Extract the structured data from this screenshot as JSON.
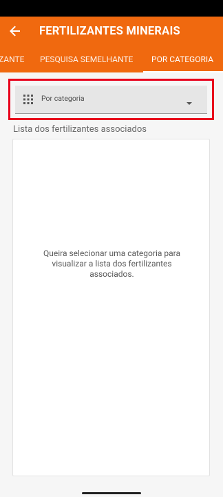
{
  "app_bar": {
    "title": "FERTILIZANTES MINERAIS",
    "back_icon": "arrow-left-icon"
  },
  "tabs": [
    {
      "label": "ZANTE",
      "active": false
    },
    {
      "label": "PESQUISA SEMELHANTE",
      "active": false
    },
    {
      "label": "POR CATEGORIA",
      "active": true
    }
  ],
  "category_select": {
    "icon": "apps-grid-icon",
    "placeholder": "Por categoria"
  },
  "list": {
    "heading": "Lista dos fertilizantes associados",
    "empty_message": "Queira selecionar uma categoria para visualizar a lista dos fertilizantes associados."
  },
  "colors": {
    "primary": "#f0690f",
    "highlight_frame": "#e8001c"
  }
}
